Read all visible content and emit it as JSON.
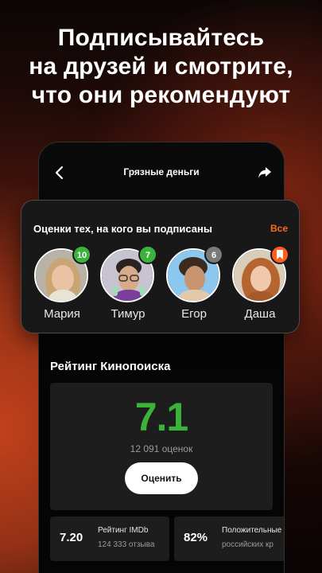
{
  "headline": {
    "line1": "Подписывайтесь",
    "line2": "на друзей и смотрите,",
    "line3": "что они рекомендуют"
  },
  "phone": {
    "title": "Грязные деньги",
    "icons": {
      "back": "chevron-left-icon",
      "share": "share-arrow-icon"
    }
  },
  "friends": {
    "title": "Оценки тех, на кого вы подписаны",
    "all_link": "Все",
    "items": [
      {
        "name": "Мария",
        "badge": "10",
        "badge_color": "#3bb33b"
      },
      {
        "name": "Тимур",
        "badge": "7",
        "badge_color": "#3bb33b"
      },
      {
        "name": "Егор",
        "badge": "6",
        "badge_color": "#7a7a7a"
      },
      {
        "name": "Даша",
        "badge": "",
        "badge_icon": "bookmark-icon",
        "badge_color": "#ff5a1f"
      }
    ]
  },
  "rating": {
    "section_title": "Рейтинг Кинопоиска",
    "value": "7.1",
    "count": "12 091 оценок",
    "rate_button": "Оценить",
    "value_color": "#3bb33b"
  },
  "stats": {
    "imdb": {
      "value": "7.20",
      "label": "Рейтинг IMDb",
      "sub": "124 333 отзыва"
    },
    "critics": {
      "value": "82%",
      "label": "Положительные",
      "sub": "российских кр"
    }
  },
  "colors": {
    "accent": "#ff6a1a",
    "good": "#3bb33b",
    "neutral": "#7a7a7a"
  }
}
